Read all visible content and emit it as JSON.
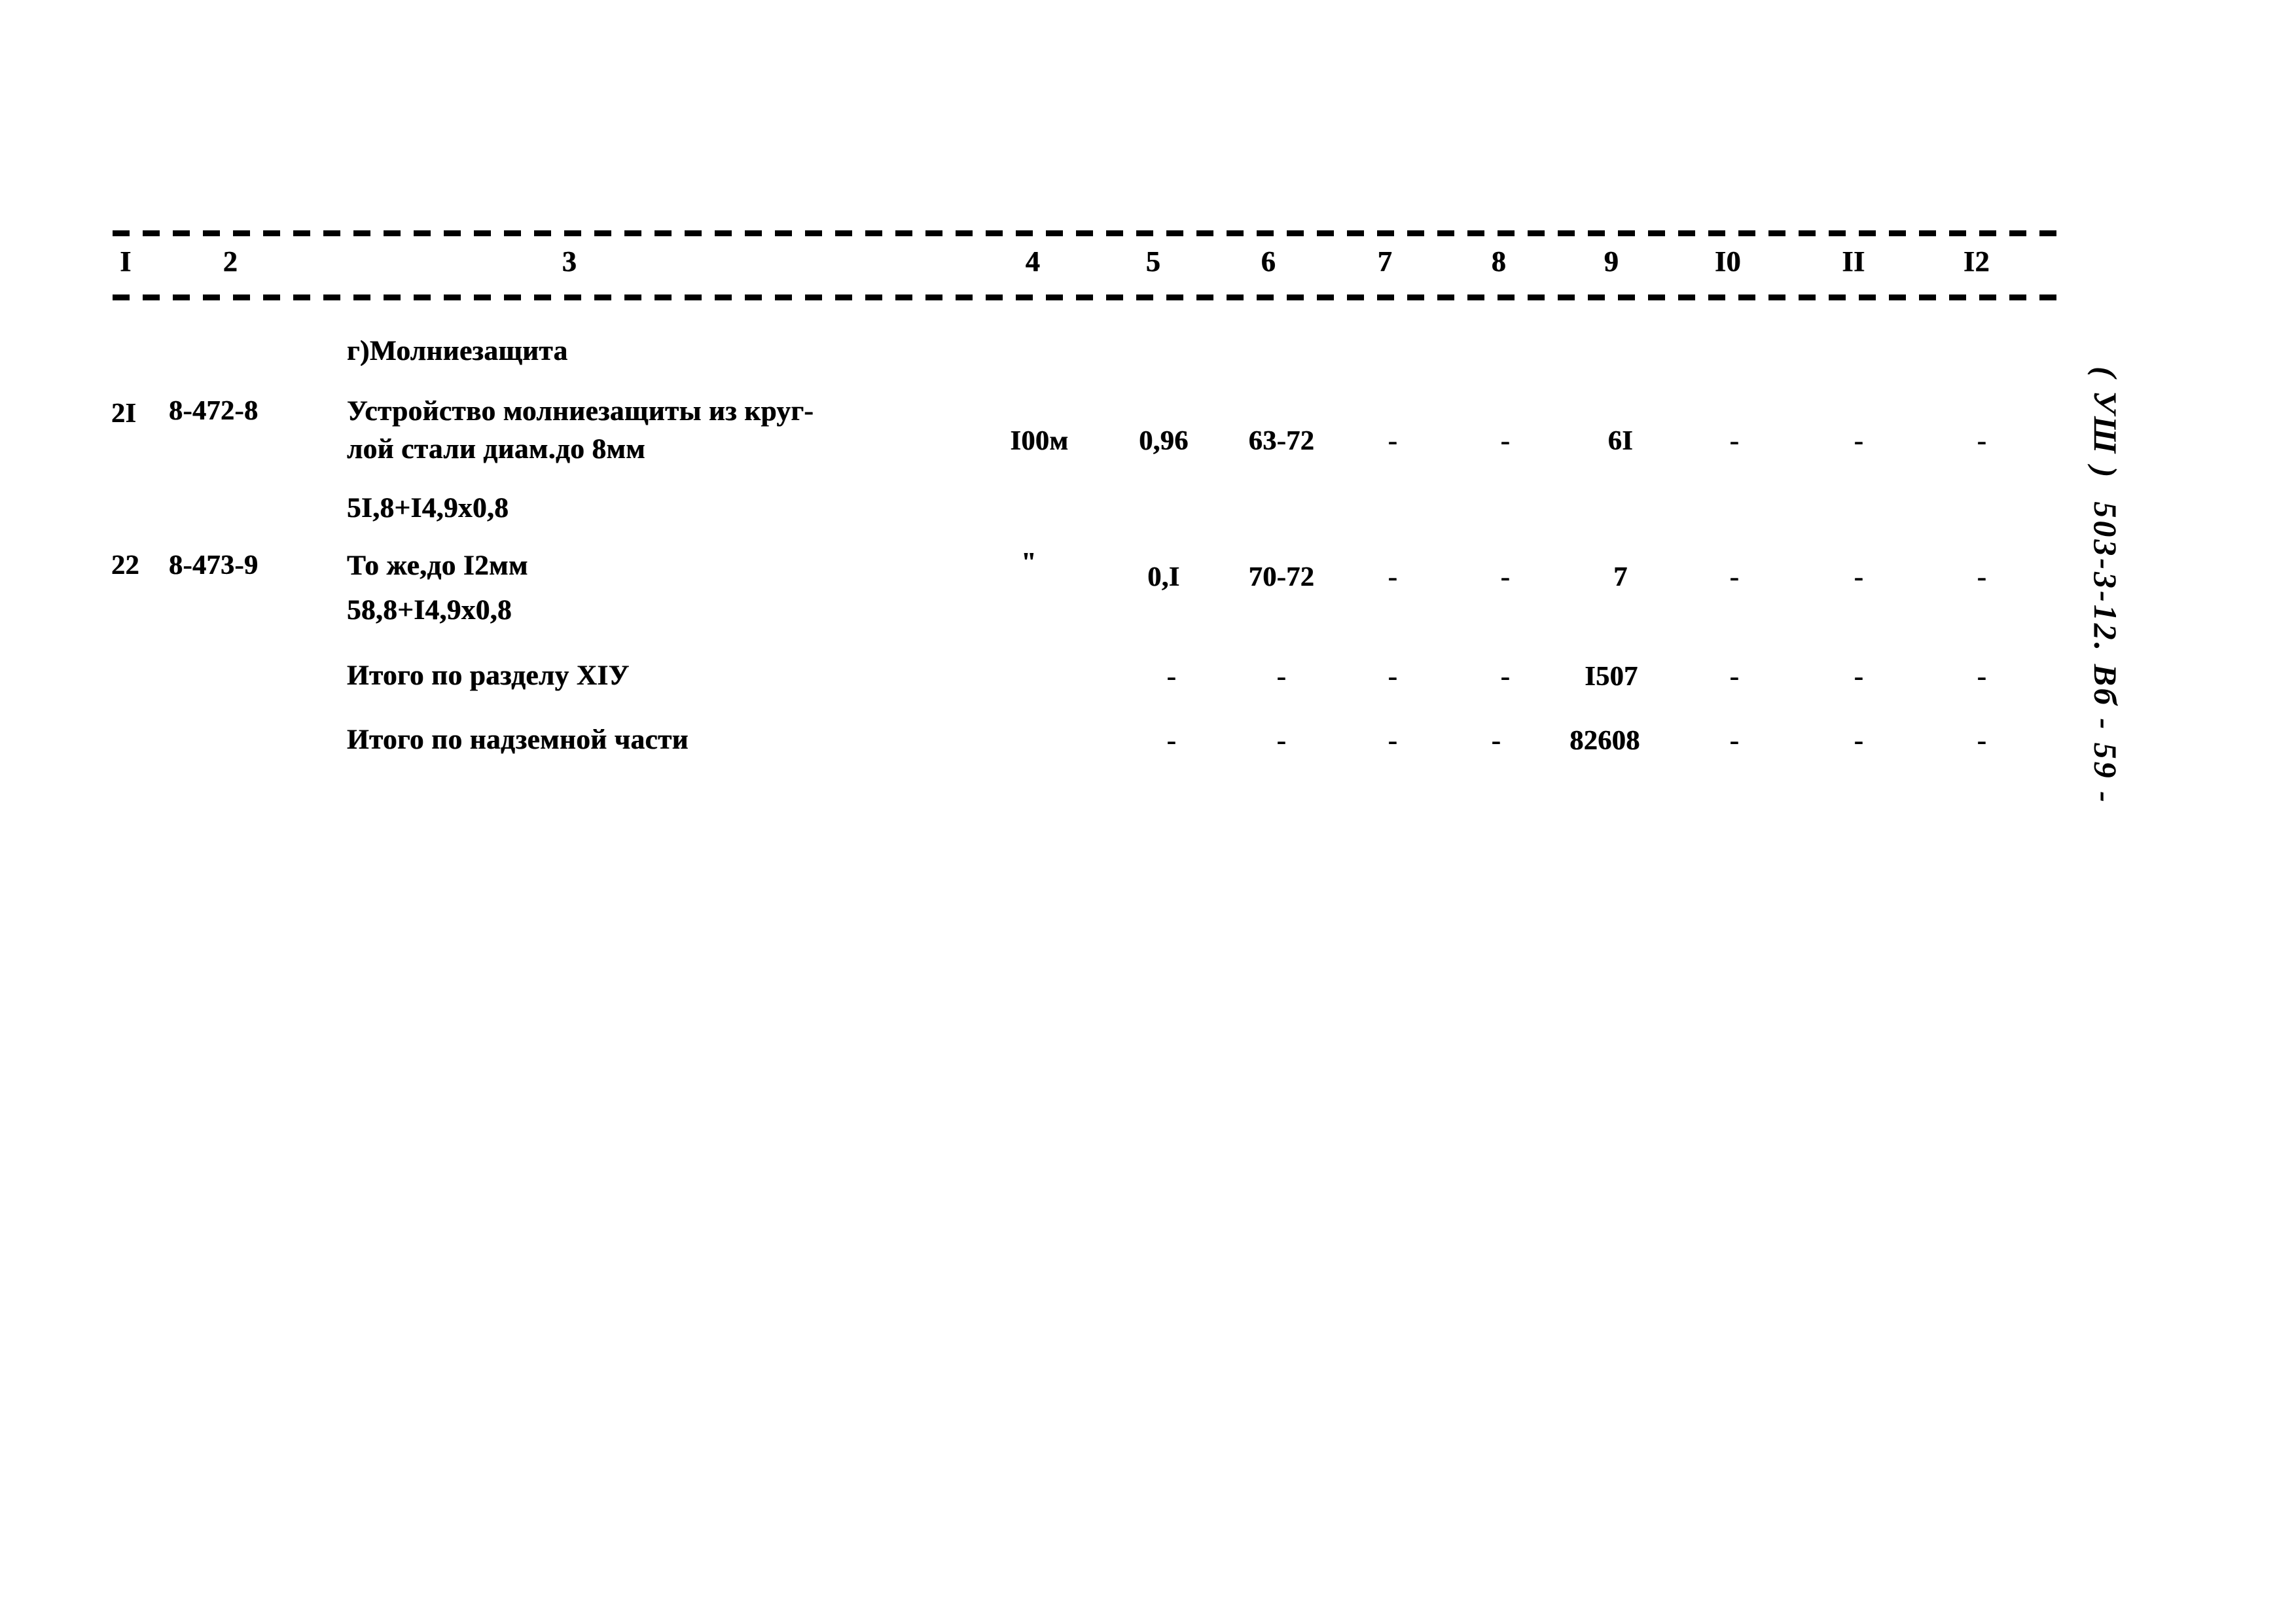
{
  "document": {
    "kind": "scanned-estimate-table",
    "margin_note": "( УШ )  503-3-12. Вб - 59 -"
  },
  "table": {
    "column_headers": [
      "I",
      "2",
      "3",
      "4",
      "5",
      "6",
      "7",
      "8",
      "9",
      "I0",
      "II",
      "I2"
    ],
    "section_heading": "г)Молниезащита",
    "rows": [
      {
        "type": "item",
        "idx": "2I",
        "code": "8-472-8",
        "desc_line1": "Устройство молниезащиты из круг-",
        "desc_line2": "лой стали диам.до 8мм",
        "desc_line3": "5I,8+I4,9х0,8",
        "c4": "I00м",
        "c5": "0,96",
        "c6": "63-72",
        "c7": "-",
        "c8": "-",
        "c9": "6I",
        "c10": "-",
        "c11": "-",
        "c12": "-"
      },
      {
        "type": "item",
        "idx": "22",
        "code": "8-473-9",
        "desc_line1": "То же,до I2мм",
        "desc_line2": "58,8+I4,9х0,8",
        "desc_line3": "",
        "c4": "\"",
        "c5": "0,I",
        "c6": "70-72",
        "c7": "-",
        "c8": "-",
        "c9": "7",
        "c10": "-",
        "c11": "-",
        "c12": "-"
      },
      {
        "type": "total",
        "idx": "",
        "code": "",
        "desc_line1": "Итого по разделу ХIУ",
        "desc_line2": "",
        "desc_line3": "",
        "c4": "",
        "c5": "-",
        "c6": "-",
        "c7": "-",
        "c8": "-",
        "c9": "I507",
        "c10": "-",
        "c11": "-",
        "c12": "-"
      },
      {
        "type": "total",
        "idx": "",
        "code": "",
        "desc_line1": "Итого по надземной части",
        "desc_line2": "",
        "desc_line3": "",
        "c4": "",
        "c5": "-",
        "c6": "-",
        "c7": "-",
        "c8": "-",
        "c9": "82608",
        "c10": "-",
        "c11": "-",
        "c12": "-"
      }
    ]
  }
}
